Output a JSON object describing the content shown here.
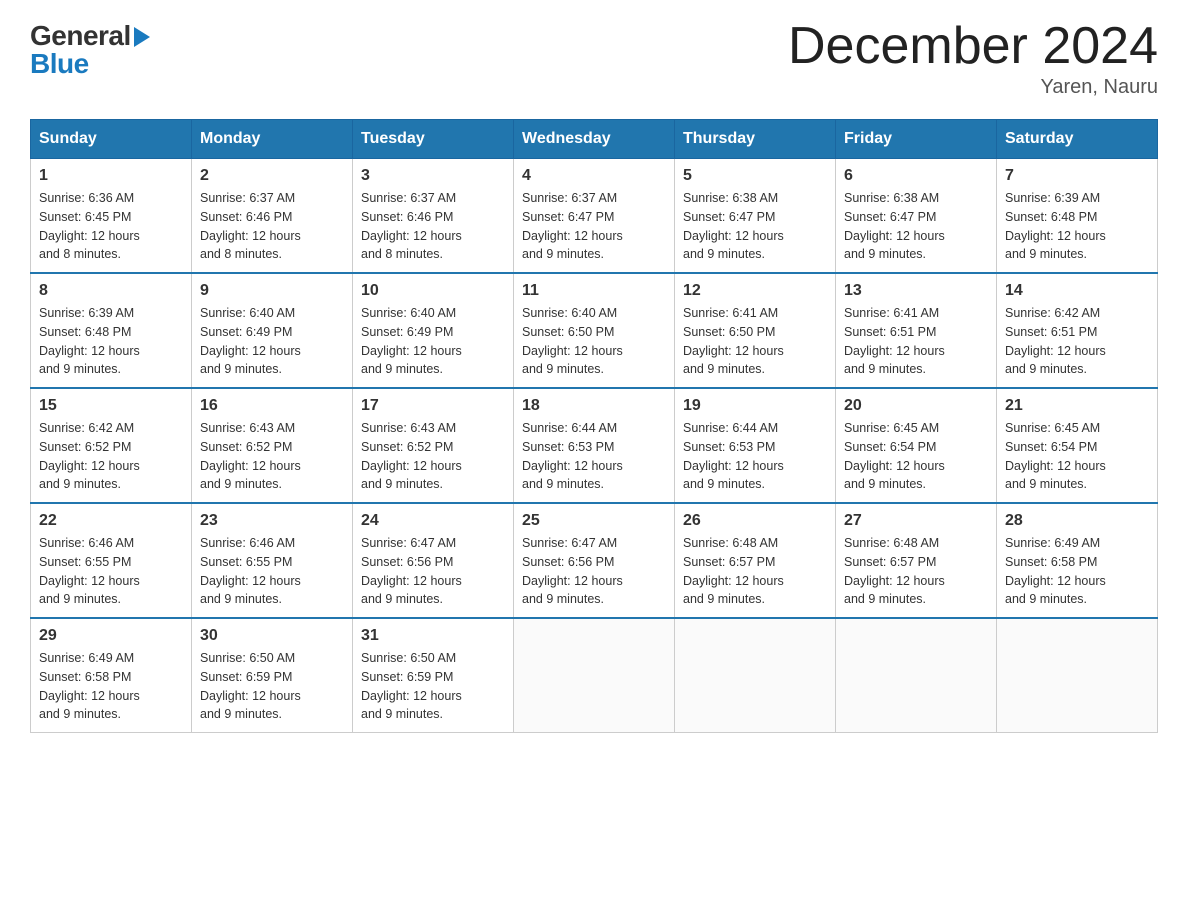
{
  "header": {
    "title": "December 2024",
    "subtitle": "Yaren, Nauru",
    "logo_general": "General",
    "logo_blue": "Blue"
  },
  "calendar": {
    "days_of_week": [
      "Sunday",
      "Monday",
      "Tuesday",
      "Wednesday",
      "Thursday",
      "Friday",
      "Saturday"
    ],
    "weeks": [
      [
        {
          "day": "1",
          "sunrise": "6:36 AM",
          "sunset": "6:45 PM",
          "daylight": "12 hours and 8 minutes."
        },
        {
          "day": "2",
          "sunrise": "6:37 AM",
          "sunset": "6:46 PM",
          "daylight": "12 hours and 8 minutes."
        },
        {
          "day": "3",
          "sunrise": "6:37 AM",
          "sunset": "6:46 PM",
          "daylight": "12 hours and 8 minutes."
        },
        {
          "day": "4",
          "sunrise": "6:37 AM",
          "sunset": "6:47 PM",
          "daylight": "12 hours and 9 minutes."
        },
        {
          "day": "5",
          "sunrise": "6:38 AM",
          "sunset": "6:47 PM",
          "daylight": "12 hours and 9 minutes."
        },
        {
          "day": "6",
          "sunrise": "6:38 AM",
          "sunset": "6:47 PM",
          "daylight": "12 hours and 9 minutes."
        },
        {
          "day": "7",
          "sunrise": "6:39 AM",
          "sunset": "6:48 PM",
          "daylight": "12 hours and 9 minutes."
        }
      ],
      [
        {
          "day": "8",
          "sunrise": "6:39 AM",
          "sunset": "6:48 PM",
          "daylight": "12 hours and 9 minutes."
        },
        {
          "day": "9",
          "sunrise": "6:40 AM",
          "sunset": "6:49 PM",
          "daylight": "12 hours and 9 minutes."
        },
        {
          "day": "10",
          "sunrise": "6:40 AM",
          "sunset": "6:49 PM",
          "daylight": "12 hours and 9 minutes."
        },
        {
          "day": "11",
          "sunrise": "6:40 AM",
          "sunset": "6:50 PM",
          "daylight": "12 hours and 9 minutes."
        },
        {
          "day": "12",
          "sunrise": "6:41 AM",
          "sunset": "6:50 PM",
          "daylight": "12 hours and 9 minutes."
        },
        {
          "day": "13",
          "sunrise": "6:41 AM",
          "sunset": "6:51 PM",
          "daylight": "12 hours and 9 minutes."
        },
        {
          "day": "14",
          "sunrise": "6:42 AM",
          "sunset": "6:51 PM",
          "daylight": "12 hours and 9 minutes."
        }
      ],
      [
        {
          "day": "15",
          "sunrise": "6:42 AM",
          "sunset": "6:52 PM",
          "daylight": "12 hours and 9 minutes."
        },
        {
          "day": "16",
          "sunrise": "6:43 AM",
          "sunset": "6:52 PM",
          "daylight": "12 hours and 9 minutes."
        },
        {
          "day": "17",
          "sunrise": "6:43 AM",
          "sunset": "6:52 PM",
          "daylight": "12 hours and 9 minutes."
        },
        {
          "day": "18",
          "sunrise": "6:44 AM",
          "sunset": "6:53 PM",
          "daylight": "12 hours and 9 minutes."
        },
        {
          "day": "19",
          "sunrise": "6:44 AM",
          "sunset": "6:53 PM",
          "daylight": "12 hours and 9 minutes."
        },
        {
          "day": "20",
          "sunrise": "6:45 AM",
          "sunset": "6:54 PM",
          "daylight": "12 hours and 9 minutes."
        },
        {
          "day": "21",
          "sunrise": "6:45 AM",
          "sunset": "6:54 PM",
          "daylight": "12 hours and 9 minutes."
        }
      ],
      [
        {
          "day": "22",
          "sunrise": "6:46 AM",
          "sunset": "6:55 PM",
          "daylight": "12 hours and 9 minutes."
        },
        {
          "day": "23",
          "sunrise": "6:46 AM",
          "sunset": "6:55 PM",
          "daylight": "12 hours and 9 minutes."
        },
        {
          "day": "24",
          "sunrise": "6:47 AM",
          "sunset": "6:56 PM",
          "daylight": "12 hours and 9 minutes."
        },
        {
          "day": "25",
          "sunrise": "6:47 AM",
          "sunset": "6:56 PM",
          "daylight": "12 hours and 9 minutes."
        },
        {
          "day": "26",
          "sunrise": "6:48 AM",
          "sunset": "6:57 PM",
          "daylight": "12 hours and 9 minutes."
        },
        {
          "day": "27",
          "sunrise": "6:48 AM",
          "sunset": "6:57 PM",
          "daylight": "12 hours and 9 minutes."
        },
        {
          "day": "28",
          "sunrise": "6:49 AM",
          "sunset": "6:58 PM",
          "daylight": "12 hours and 9 minutes."
        }
      ],
      [
        {
          "day": "29",
          "sunrise": "6:49 AM",
          "sunset": "6:58 PM",
          "daylight": "12 hours and 9 minutes."
        },
        {
          "day": "30",
          "sunrise": "6:50 AM",
          "sunset": "6:59 PM",
          "daylight": "12 hours and 9 minutes."
        },
        {
          "day": "31",
          "sunrise": "6:50 AM",
          "sunset": "6:59 PM",
          "daylight": "12 hours and 9 minutes."
        },
        null,
        null,
        null,
        null
      ]
    ],
    "labels": {
      "sunrise": "Sunrise:",
      "sunset": "Sunset:",
      "daylight": "Daylight:"
    }
  }
}
